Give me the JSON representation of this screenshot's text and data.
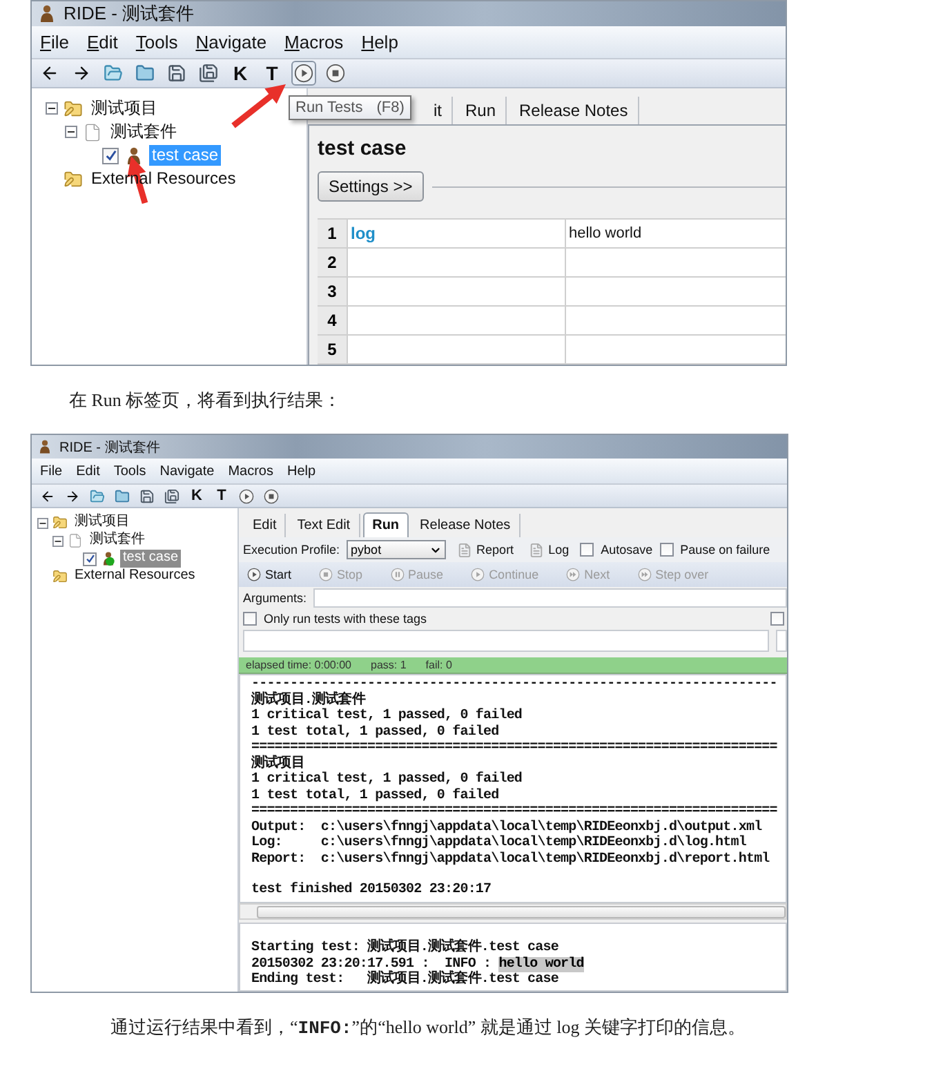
{
  "figure_1": {
    "window_title": "RIDE - 测试套件",
    "menu": [
      "File",
      "Edit",
      "Tools",
      "Navigate",
      "Macros",
      "Help"
    ],
    "menu_accelerators_shown": true,
    "toolbar": [
      {
        "kind": "back",
        "hovered": false
      },
      {
        "kind": "forward",
        "hovered": false
      },
      {
        "kind": "open",
        "hovered": false
      },
      {
        "kind": "open-dir",
        "hovered": false
      },
      {
        "kind": "save",
        "hovered": false
      },
      {
        "kind": "save-all",
        "hovered": false
      },
      {
        "kind": "keyword-search",
        "label": "K",
        "hovered": false
      },
      {
        "kind": "test-search",
        "label": "T",
        "hovered": false
      },
      {
        "kind": "run",
        "hovered": true
      },
      {
        "kind": "stop",
        "hovered": false
      }
    ],
    "tooltip": {
      "label": "Run Tests",
      "shortcut": "(F8)"
    },
    "tree_focused": true,
    "tree": [
      {
        "label": "测试项目",
        "kind": "folder",
        "expanded": true,
        "selected": false,
        "children": [
          {
            "label": "测试套件",
            "kind": "suite",
            "expanded": true,
            "selected": false,
            "children": [
              {
                "label": "test case",
                "kind": "test",
                "passed": false,
                "checked": true,
                "selected": true
              }
            ]
          }
        ]
      },
      {
        "label": "External Resources",
        "kind": "folder",
        "selected": false
      }
    ],
    "tabs": [
      {
        "label": "it",
        "selected": false
      },
      {
        "label": "Run",
        "selected": false
      },
      {
        "label": "Release Notes",
        "selected": false
      }
    ],
    "editor": {
      "title": "test case",
      "settings_button": "Settings >>",
      "rows": [
        {
          "number": "1",
          "cells": [
            "log",
            "hello world"
          ]
        },
        {
          "number": "2",
          "cells": []
        },
        {
          "number": "3",
          "cells": []
        },
        {
          "number": "4",
          "cells": []
        },
        {
          "number": "5",
          "cells": []
        }
      ]
    }
  },
  "caption_1": "在 Run 标签页，将看到执行结果：",
  "figure_2": {
    "window_title": "RIDE - 测试套件",
    "menu": [
      "File",
      "Edit",
      "Tools",
      "Navigate",
      "Macros",
      "Help"
    ],
    "menu_accelerators_shown": false,
    "toolbar": [
      {
        "kind": "back",
        "hovered": false
      },
      {
        "kind": "forward",
        "hovered": false
      },
      {
        "kind": "open",
        "hovered": false
      },
      {
        "kind": "open-dir",
        "hovered": false
      },
      {
        "kind": "save",
        "hovered": false
      },
      {
        "kind": "save-all",
        "hovered": false
      },
      {
        "kind": "keyword-search",
        "label": "K",
        "hovered": false
      },
      {
        "kind": "test-search",
        "label": "T",
        "hovered": false
      },
      {
        "kind": "run",
        "hovered": false
      },
      {
        "kind": "stop",
        "hovered": false
      }
    ],
    "tree_focused": false,
    "tree": [
      {
        "label": "测试项目",
        "kind": "folder",
        "expanded": true,
        "selected": false,
        "children": [
          {
            "label": "测试套件",
            "kind": "suite",
            "expanded": true,
            "selected": false,
            "children": [
              {
                "label": "test case",
                "kind": "test",
                "passed": true,
                "checked": true,
                "selected": true
              }
            ]
          }
        ]
      },
      {
        "label": "External Resources",
        "kind": "folder",
        "selected": false
      }
    ],
    "tabs": [
      {
        "label": "Edit",
        "selected": false
      },
      {
        "label": "Text Edit",
        "selected": false
      },
      {
        "label": "Run",
        "selected": true
      },
      {
        "label": "Release Notes",
        "selected": false
      }
    ],
    "run_panel": {
      "profile_label": "Execution Profile:",
      "profile": "pybot",
      "report_button": "Report",
      "log_button": "Log",
      "options": [
        {
          "label": "Autosave",
          "checked": false
        },
        {
          "label": "Pause on failure",
          "checked": false
        }
      ],
      "controls": [
        {
          "label": "Start",
          "kind": "play",
          "disabled": false
        },
        {
          "label": "Stop",
          "kind": "stop",
          "disabled": true
        },
        {
          "label": "Pause",
          "kind": "pause",
          "disabled": true
        },
        {
          "label": "Continue",
          "kind": "play",
          "disabled": true
        },
        {
          "label": "Next",
          "kind": "next",
          "disabled": true
        },
        {
          "label": "Step over",
          "kind": "next",
          "disabled": true
        }
      ],
      "arguments_label": "Arguments:",
      "tag_filters": [
        {
          "label": "Only run tests with these tags",
          "checked": false
        },
        {
          "checked": false
        }
      ],
      "status": {
        "elapsed": "elapsed time: 0:00:00",
        "pass": "pass: 1",
        "fail": "fail: 0",
        "passed": true
      },
      "output_lines": [
        "--------------------------------------------------------------------",
        "测试项目.测试套件",
        "1 critical test, 1 passed, 0 failed",
        "1 test total, 1 passed, 0 failed",
        "====================================================================",
        "测试项目",
        "1 critical test, 1 passed, 0 failed",
        "1 test total, 1 passed, 0 failed",
        "====================================================================",
        "Output:  c:\\users\\fnngj\\appdata\\local\\temp\\RIDEeonxbj.d\\output.xml",
        "Log:     c:\\users\\fnngj\\appdata\\local\\temp\\RIDEeonxbj.d\\log.html",
        "Report:  c:\\users\\fnngj\\appdata\\local\\temp\\RIDEeonxbj.d\\report.html"
      ],
      "finish_line": "test finished 20150302 23:20:17",
      "log_lines": [
        {
          "text": "Starting test: 测试项目.测试套件.test case"
        },
        {
          "text": "20150302 23:20:17.591 :  INFO : ",
          "highlight": "hello world"
        },
        {
          "text": "Ending test:   测试项目.测试套件.test case"
        }
      ]
    }
  },
  "caption_2": "通过运行结果中看到，“**INFO:**”的“hello world” 就是通过 log 关键字打印的信息。"
}
